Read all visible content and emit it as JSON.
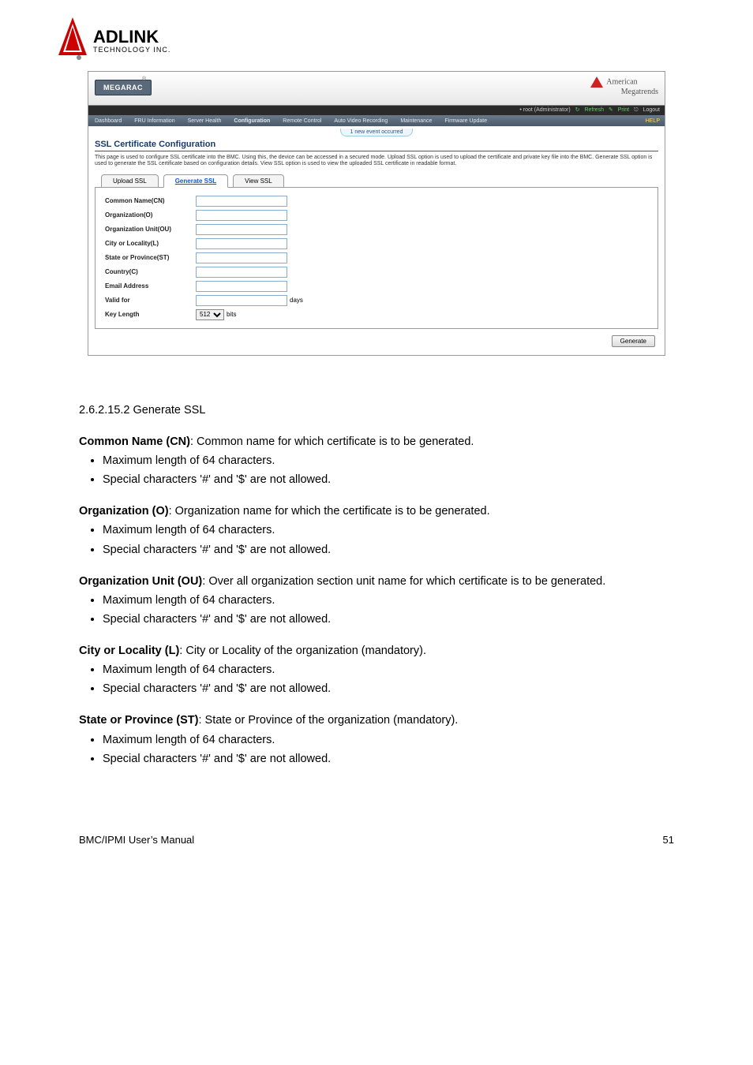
{
  "logo": {
    "brand": "ADLINK",
    "sub": "TECHNOLOGY INC."
  },
  "screenshot": {
    "product": "MEGARAC",
    "reg": "®",
    "ami_line1": "American",
    "ami_line2": "Megatrends",
    "util": {
      "user": "• root (Administrator)",
      "refresh": "Refresh",
      "print": "Print",
      "logout": "Logout"
    },
    "nav": [
      "Dashboard",
      "FRU Information",
      "Server Health",
      "Configuration",
      "Remote Control",
      "Auto Video Recording",
      "Maintenance",
      "Firmware Update"
    ],
    "nav_help": "HELP",
    "event_pill": "1 new event occurred",
    "page_title": "SSL Certificate Configuration",
    "page_desc": "This page is used to configure SSL certificate into the BMC. Using this, the device can be accessed in a secured mode. Upload SSL option is used to upload the certificate and private key file into the BMC. Generate SSL option is used to generate the SSL certificate based on configuration details. View SSL option is used to view the uploaded SSL certificate in readable format.",
    "tabs": [
      "Upload SSL",
      "Generate SSL",
      "View SSL"
    ],
    "fields": {
      "cn": "Common Name(CN)",
      "o": "Organization(O)",
      "ou": "Organization Unit(OU)",
      "l": "City or Locality(L)",
      "st": "State or Province(ST)",
      "c": "Country(C)",
      "email": "Email Address",
      "valid": "Valid for",
      "valid_suffix": "days",
      "keylen": "Key Length",
      "keylen_val": "512",
      "keylen_suffix": "bits"
    },
    "generate_btn": "Generate"
  },
  "doc": {
    "caption": "2.6.2.15.2 Generate SSL",
    "cn_head": "Common Name (CN)",
    "cn_desc": ": Common name for which certificate is to be generated.",
    "cn_b1": "Maximum length of 64 characters.",
    "cn_b2": "Special characters '#' and '$' are not allowed.",
    "o_head": "Organization (O)",
    "o_desc": ": Organization name for which the certificate is to be generated.",
    "o_b1": "Maximum length of 64 characters.",
    "o_b2": "Special characters '#' and '$' are not allowed.",
    "ou_head": "Organization Unit (OU)",
    "ou_desc": ": Over all organization section unit name for which certificate is to be generated.",
    "ou_b1": "Maximum length of 64 characters.",
    "ou_b2": "Special characters '#' and '$' are not allowed.",
    "l_head": "City or Locality (L)",
    "l_desc": ": City or Locality of the organization (mandatory).",
    "l_b1": "Maximum length of 64 characters.",
    "l_b2": "Special characters '#' and '$' are not allowed.",
    "st_head": "State or Province (ST)",
    "st_desc": ": State or Province of the organization (mandatory).",
    "st_b1": "Maximum length of 64 characters.",
    "st_b2": "Special characters '#' and '$' are not allowed."
  },
  "footer": {
    "left": "BMC/IPMI User’s Manual",
    "right": "51"
  }
}
